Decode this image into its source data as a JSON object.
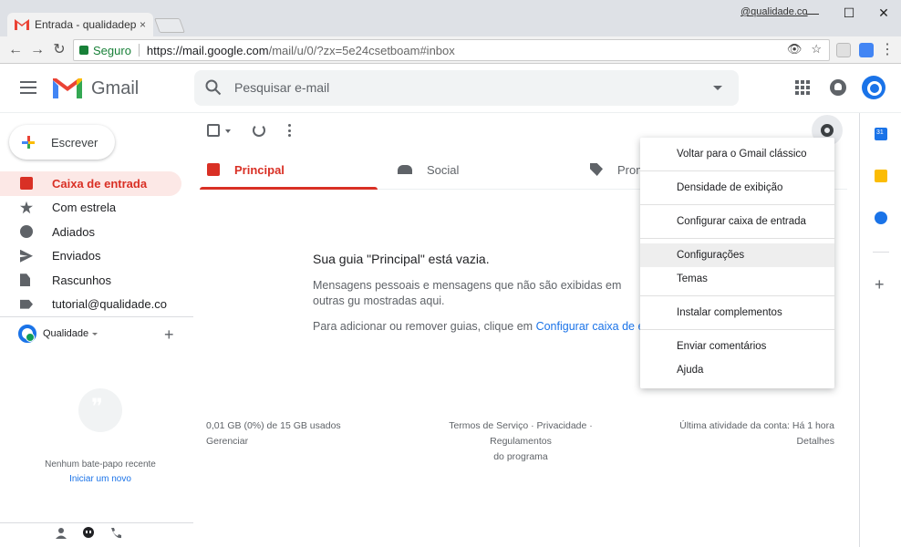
{
  "browser": {
    "tab_title": "Entrada - qualidadepontoco",
    "tab_close": "×",
    "profile": "@qualidade.co",
    "win_min": "—",
    "win_max": "☐",
    "win_close": "✕",
    "back": "←",
    "forward": "→",
    "reload": "↻",
    "secure_label": "Seguro",
    "url_host": "https://mail.google.com",
    "url_path": "/mail/u/0/?zx=5e24csetboam#inbox",
    "omni_eye": "👁",
    "omni_star": "☆",
    "menu_dots": "⋮"
  },
  "header": {
    "logo_text": "Gmail",
    "search_placeholder": "Pesquisar e-mail"
  },
  "sidebar": {
    "compose_label": "Escrever",
    "items": [
      {
        "label": "Caixa de entrada",
        "icon": "inbox-icon"
      },
      {
        "label": "Com estrela",
        "icon": "star-icon"
      },
      {
        "label": "Adiados",
        "icon": "clock-icon"
      },
      {
        "label": "Enviados",
        "icon": "send-icon"
      },
      {
        "label": "Rascunhos",
        "icon": "draft-icon"
      },
      {
        "label": "tutorial@qualidade.co",
        "icon": "label-icon"
      }
    ],
    "hangouts_account": "Qualidade",
    "hangouts_add": "+",
    "no_chat": "Nenhum bate-papo recente",
    "start_new": "Iniciar um novo"
  },
  "main": {
    "tabs": [
      {
        "label": "Principal",
        "icon": "inbox-icon"
      },
      {
        "label": "Social",
        "icon": "people-icon"
      },
      {
        "label": "Prom",
        "icon": "tag-icon"
      }
    ],
    "empty_title": "Sua guia \"Principal\" está vazia.",
    "empty_desc": "Mensagens pessoais e mensagens que não são exibidas em outras gu mostradas aqui.",
    "empty_help_prefix": "Para adicionar ou remover guias, clique em ",
    "empty_help_link": "Configurar caixa de entrad"
  },
  "footer": {
    "storage": "0,01 GB (0%) de 15 GB usados",
    "manage": "Gerenciar",
    "terms_line1": "Termos de Serviço · Privacidade · Regulamentos",
    "terms_line2": "do programa",
    "activity": "Última atividade da conta: Há 1 hora",
    "details": "Detalhes"
  },
  "settings_menu": {
    "items": [
      "Voltar para o Gmail clássico",
      "Densidade de exibição",
      "Configurar caixa de entrada",
      "Configurações",
      "Temas",
      "Instalar complementos",
      "Enviar comentários",
      "Ajuda"
    ]
  },
  "colors": {
    "accent_red": "#d93025",
    "link_blue": "#1a73e8",
    "secure_green": "#188038"
  }
}
